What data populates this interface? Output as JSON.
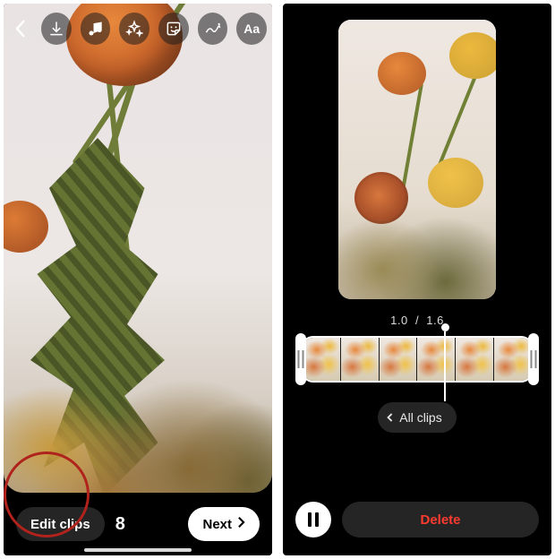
{
  "colors": {
    "accent_red": "#ff3b30",
    "highlight_ring": "#b0231c"
  },
  "left_editor": {
    "toolbar": {
      "back_icon": "chevron-left-icon",
      "tools": [
        {
          "name": "download-icon"
        },
        {
          "name": "music-icon"
        },
        {
          "name": "sparkle-effects-icon"
        },
        {
          "name": "sticker-icon"
        },
        {
          "name": "draw-icon"
        },
        {
          "name": "text-aa-icon"
        }
      ]
    },
    "bottom": {
      "edit_clips_label": "Edit clips",
      "clip_count": "8",
      "next_label": "Next"
    },
    "highlight_target": "edit-clips-button"
  },
  "right_clip_editor": {
    "time": {
      "current": "1.0",
      "separator": "/",
      "total": "1.6"
    },
    "thumbnail_count": 6,
    "playhead_position_pct": 62,
    "all_clips_label": "All clips",
    "controls": {
      "play_state": "playing",
      "play_icon": "pause-icon",
      "delete_label": "Delete"
    }
  }
}
